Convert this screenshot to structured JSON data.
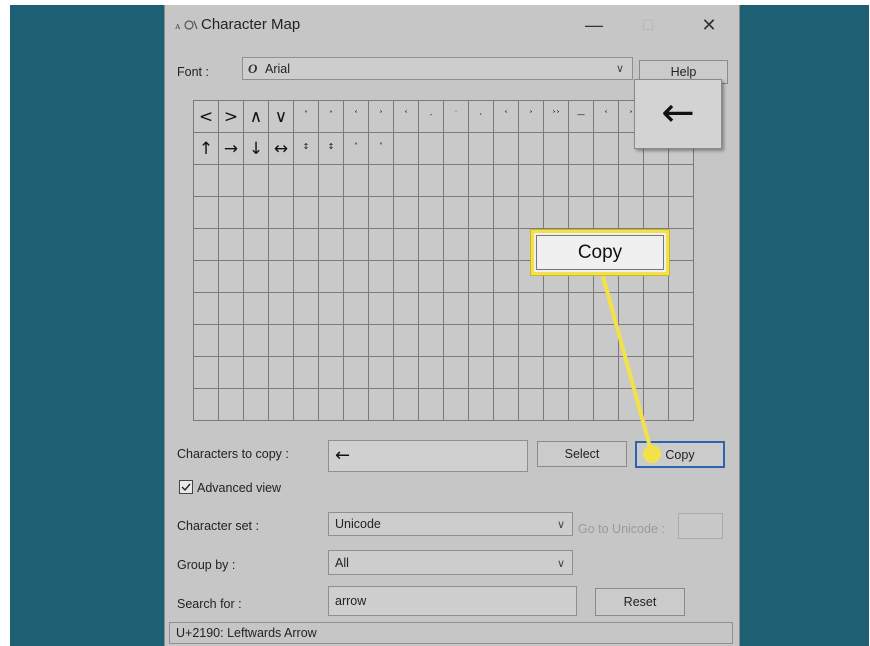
{
  "window": {
    "title": "Character Map",
    "controls": {
      "minimize": "—",
      "maximize": "☐",
      "close": "✕"
    }
  },
  "font": {
    "label": "Font :",
    "value": "Arial",
    "icon": "opentype-font-icon"
  },
  "help_label": "Help",
  "grid": {
    "rows": [
      [
        "<",
        ">",
        "∧",
        "∨",
        "˅",
        "˄",
        "˂",
        "˃",
        "˂",
        "˗",
        "˙",
        "˒",
        "˂",
        "˃",
        "˃˃",
        "—",
        "˂",
        "˃",
        "",
        ""
      ],
      [
        "↑",
        "→",
        "↓",
        "↔",
        "↕",
        "↕",
        "˄",
        "˅",
        "",
        "",
        "",
        "",
        "",
        "",
        "",
        "",
        "",
        "",
        "",
        ""
      ]
    ],
    "small_columns_from": 4,
    "total_rows": 10,
    "columns": 20
  },
  "zoom_char": "←",
  "characters_to_copy": {
    "label": "Characters to copy :",
    "value": "←"
  },
  "select_label": "Select",
  "copy_label": "Copy",
  "advanced_view": {
    "label": "Advanced view",
    "checked": true
  },
  "character_set": {
    "label": "Character set :",
    "value": "Unicode"
  },
  "go_to_unicode_label": "Go to Unicode :",
  "group_by": {
    "label": "Group by :",
    "value": "All"
  },
  "search_for": {
    "label": "Search for :",
    "value": "arrow"
  },
  "reset_label": "Reset",
  "status_text": "U+2190: Leftwards Arrow",
  "callout_label": "Copy",
  "colors": {
    "background": "#1f5f73",
    "window": "#c6c6c6",
    "highlight": "#f3e14a"
  }
}
